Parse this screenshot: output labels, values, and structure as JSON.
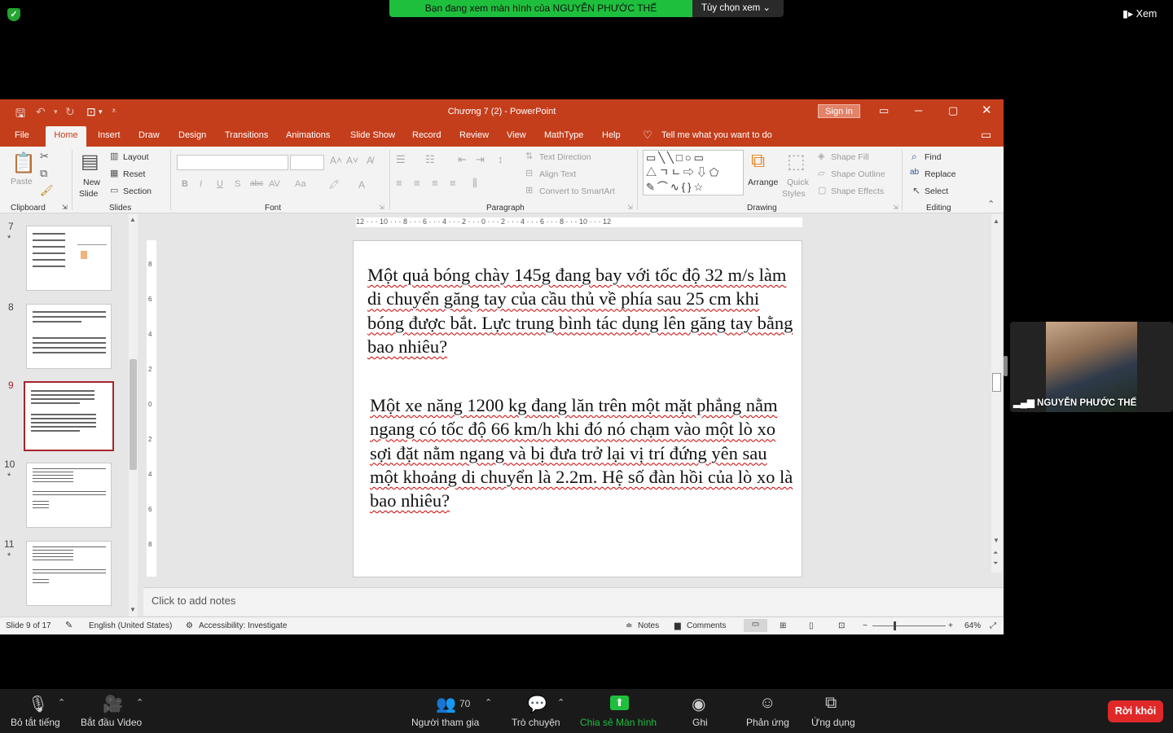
{
  "zoom_top": {
    "share_banner": "Bạn đang xem màn hình của NGUYỄN PHƯỚC THẾ",
    "view_options": "Tùy chọn xem",
    "view_button": "Xem"
  },
  "ppt": {
    "title": "Chương 7 (2)  -  PowerPoint",
    "sign_in": "Sign in",
    "tabs": [
      "File",
      "Home",
      "Insert",
      "Draw",
      "Design",
      "Transitions",
      "Animations",
      "Slide Show",
      "Record",
      "Review",
      "View",
      "MathType",
      "Help"
    ],
    "tell_me": "Tell me what you want to do",
    "ribbon": {
      "clipboard": {
        "label": "Clipboard",
        "paste": "Paste"
      },
      "slides": {
        "label": "Slides",
        "new_slide": "New",
        "new_slide2": "Slide",
        "layout": "Layout",
        "reset": "Reset",
        "section": "Section"
      },
      "font": {
        "label": "Font"
      },
      "paragraph": {
        "label": "Paragraph",
        "text_direction": "Text Direction",
        "align_text": "Align Text",
        "convert_smartart": "Convert to SmartArt"
      },
      "drawing": {
        "label": "Drawing",
        "arrange": "Arrange",
        "quick_styles": "Quick",
        "quick_styles2": "Styles",
        "shape_fill": "Shape Fill",
        "shape_outline": "Shape Outline",
        "shape_effects": "Shape Effects"
      },
      "editing": {
        "label": "Editing",
        "find": "Find",
        "replace": "Replace",
        "select": "Select"
      }
    },
    "thumbnails": [
      {
        "num": "7",
        "star": "*"
      },
      {
        "num": "8",
        "star": ""
      },
      {
        "num": "9",
        "star": ""
      },
      {
        "num": "10",
        "star": "*"
      },
      {
        "num": "11",
        "star": "*"
      }
    ],
    "ruler": "12 · · · 10 · · · 8 · · · 6 · · · 4 · · · 2 · · · 0 · · · 2 · · · 4 · · · 6 · · · 8 · · · 10 · · · 12",
    "slide": {
      "para1": "Một quả bóng chày 145g đang bay với tốc độ 32 m/s làm di chuyển găng tay của cầu thủ về phía sau 25 cm khi bóng được bắt. Lực trung bình tác dụng lên găng tay bằng bao nhiêu?",
      "para2": "Một xe năng 1200 kg đang lăn trên một mặt phẳng nằm ngang có tốc độ 66 km/h khi đó nó chạm vào một lò xo sợi đặt nằm ngang và bị đưa trở lại vị trí đứng yên sau một khoảng di chuyển là 2.2m. Hệ số đàn hồi của lò xo là bao nhiêu?"
    },
    "notes_placeholder": "Click to add notes",
    "status": {
      "slide_info": "Slide 9 of 17",
      "language": "English (United States)",
      "accessibility": "Accessibility: Investigate",
      "notes": "Notes",
      "comments": "Comments",
      "zoom": "64%"
    }
  },
  "video": {
    "name": "NGUYỄN PHƯỚC THẾ"
  },
  "zoom_bottom": {
    "mute": "Bỏ tắt tiếng",
    "video": "Bắt đầu Video",
    "participants": "Người tham gia",
    "participants_count": "70",
    "chat": "Trò chuyện",
    "share": "Chia sẻ Màn hình",
    "record": "Ghi",
    "reactions": "Phản ứng",
    "apps": "Ứng dụng",
    "leave": "Rời khỏi"
  },
  "colors": {
    "ppt_accent": "#c43e1c",
    "share_green": "#1fbf3e",
    "leave_red": "#e02828"
  }
}
